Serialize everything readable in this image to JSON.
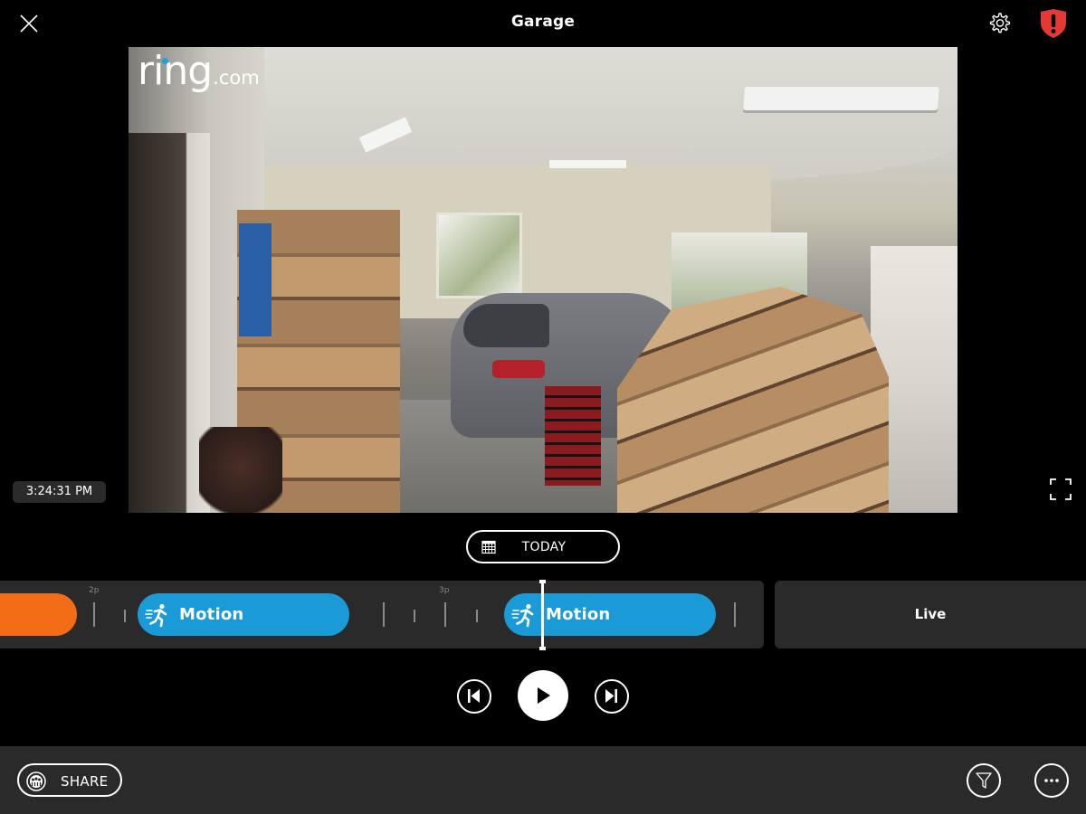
{
  "header": {
    "title": "Garage",
    "close_icon": "close-icon",
    "settings_icon": "gear-icon",
    "alert_icon": "shield-alert-icon",
    "alert_color": "#e53935"
  },
  "video": {
    "watermark_main": "ring",
    "watermark_suffix": ".com",
    "watermark_dot_color": "#1fa0e0",
    "timestamp": "3:24:31 PM",
    "fullscreen_icon": "fullscreen-icon"
  },
  "date_selector": {
    "label": "TODAY",
    "icon": "calendar-icon"
  },
  "timeline": {
    "hour_labels": [
      "2p",
      "3p"
    ],
    "events": [
      {
        "type": "ring",
        "label": "",
        "color": "#f26d16"
      },
      {
        "type": "motion",
        "label": "Motion",
        "icon": "motion-run-icon",
        "color": "#1b9ad8"
      },
      {
        "type": "motion",
        "label": "Motion",
        "icon": "motion-run-icon",
        "color": "#1b9ad8"
      }
    ],
    "live_label": "Live"
  },
  "playback": {
    "previous_icon": "skip-previous-icon",
    "play_icon": "play-icon",
    "next_icon": "skip-next-icon"
  },
  "bottom_bar": {
    "share_label": "SHARE",
    "share_icon": "neighbors-share-icon",
    "filter_icon": "filter-icon",
    "more_icon": "more-icon"
  }
}
